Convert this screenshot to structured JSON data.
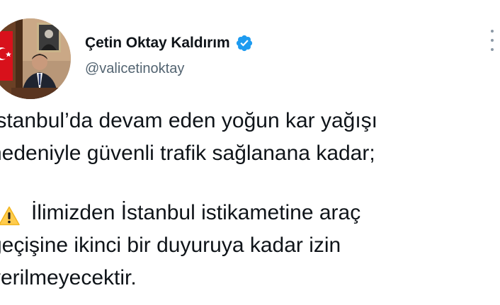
{
  "author": {
    "display_name": "Çetin Oktay Kaldırım",
    "handle": "@valicetinoktay",
    "verified_icon": "verified-badge-icon",
    "verified_color": "#1d9bf0"
  },
  "menu": {
    "icon": "more-options-icon"
  },
  "tweet": {
    "line1": "İstanbul’da devam eden yoğun kar yağışı",
    "line2": "nedeniyle güvenli trafik sağlanana kadar;",
    "warning_emoji": "warning-icon",
    "line3": "İlimizden İstanbul istikametine araç",
    "line4": "geçişine ikinci bir duyuruya kadar izin",
    "line5": "verilmeyecektir."
  }
}
